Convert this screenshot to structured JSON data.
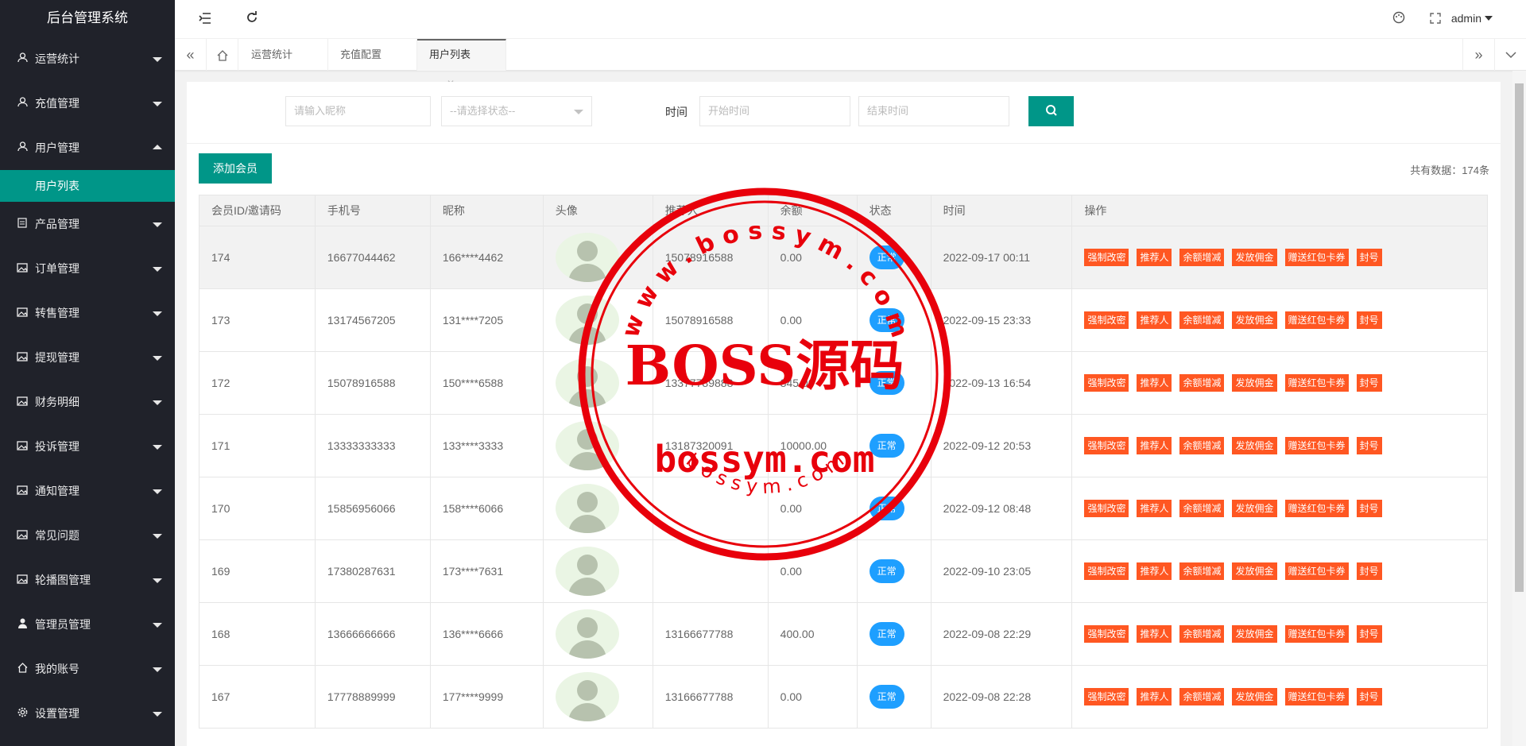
{
  "app_title": "后台管理系统",
  "sidebar": {
    "items": [
      {
        "label": "运营统计",
        "icon": "user-icon",
        "expanded": false
      },
      {
        "label": "充值管理",
        "icon": "user-icon",
        "expanded": false
      },
      {
        "label": "用户管理",
        "icon": "user-icon",
        "expanded": true
      },
      {
        "label": "产品管理",
        "icon": "document-icon",
        "expanded": false
      },
      {
        "label": "订单管理",
        "icon": "image-icon",
        "expanded": false
      },
      {
        "label": "转售管理",
        "icon": "image-icon",
        "expanded": false
      },
      {
        "label": "提现管理",
        "icon": "image-icon",
        "expanded": false
      },
      {
        "label": "财务明细",
        "icon": "image-icon",
        "expanded": false
      },
      {
        "label": "投诉管理",
        "icon": "image-icon",
        "expanded": false
      },
      {
        "label": "通知管理",
        "icon": "image-icon",
        "expanded": false
      },
      {
        "label": "常见问题",
        "icon": "image-icon",
        "expanded": false
      },
      {
        "label": "轮播图管理",
        "icon": "image-icon",
        "expanded": false
      },
      {
        "label": "管理员管理",
        "icon": "person-icon",
        "expanded": false
      },
      {
        "label": "我的账号",
        "icon": "home-icon",
        "expanded": false
      },
      {
        "label": "设置管理",
        "icon": "gear-icon",
        "expanded": false
      }
    ],
    "submenu_label": "用户列表"
  },
  "header": {
    "user": "admin"
  },
  "tabs": [
    {
      "label": "运营统计",
      "active": false
    },
    {
      "label": "充值配置",
      "active": false
    },
    {
      "label": "用户列表",
      "active": true
    }
  ],
  "search": {
    "nickname_placeholder": "请输入昵称",
    "status_placeholder": "--请选择状态--",
    "time_label": "时间",
    "start_placeholder": "开始时间",
    "end_placeholder": "结束时间"
  },
  "add_member": "添加会员",
  "total_label": "共有数据：",
  "total_value": "174条",
  "table": {
    "headers": [
      "会员ID/邀请码",
      "手机号",
      "昵称",
      "头像",
      "推荐人",
      "余额",
      "状态",
      "时间",
      "操作"
    ],
    "rows": [
      {
        "id": "174",
        "phone": "16677044462",
        "nick": "166****4462",
        "ref": "15078916588",
        "balance": "0.00",
        "status": "正常",
        "time": "2022-09-17 00:11"
      },
      {
        "id": "173",
        "phone": "13174567205",
        "nick": "131****7205",
        "ref": "15078916588",
        "balance": "0.00",
        "status": "正常",
        "time": "2022-09-15 23:33"
      },
      {
        "id": "172",
        "phone": "15078916588",
        "nick": "150****6588",
        "ref": "13377789888",
        "balance": "845.00",
        "status": "正常",
        "time": "2022-09-13 16:54"
      },
      {
        "id": "171",
        "phone": "13333333333",
        "nick": "133****3333",
        "ref": "13187320091",
        "balance": "10000.00",
        "status": "正常",
        "time": "2022-09-12 20:53"
      },
      {
        "id": "170",
        "phone": "15856956066",
        "nick": "158****6066",
        "ref": "",
        "balance": "0.00",
        "status": "正常",
        "time": "2022-09-12 08:48"
      },
      {
        "id": "169",
        "phone": "17380287631",
        "nick": "173****7631",
        "ref": "",
        "balance": "0.00",
        "status": "正常",
        "time": "2022-09-10 23:05"
      },
      {
        "id": "168",
        "phone": "13666666666",
        "nick": "136****6666",
        "ref": "13166677788",
        "balance": "400.00",
        "status": "正常",
        "time": "2022-09-08 22:29"
      },
      {
        "id": "167",
        "phone": "17778889999",
        "nick": "177****9999",
        "ref": "13166677788",
        "balance": "0.00",
        "status": "正常",
        "time": "2022-09-08 22:28"
      }
    ],
    "actions": [
      "强制改密",
      "推荐人",
      "余额增减",
      "发放佣金",
      "赠送红包卡券",
      "封号"
    ]
  },
  "watermark": {
    "top_arc": "w w w . b o s s y m . c o m",
    "main": "BOSS源码",
    "domain": "bossym.com",
    "bottom_arc": "b o s s y m . c o m"
  },
  "colors": {
    "sidebar_bg": "#20222a",
    "accent": "#009688",
    "status_blue": "#1e9fff",
    "action_orange": "#ff5722",
    "stamp_red": "#e8000b"
  }
}
